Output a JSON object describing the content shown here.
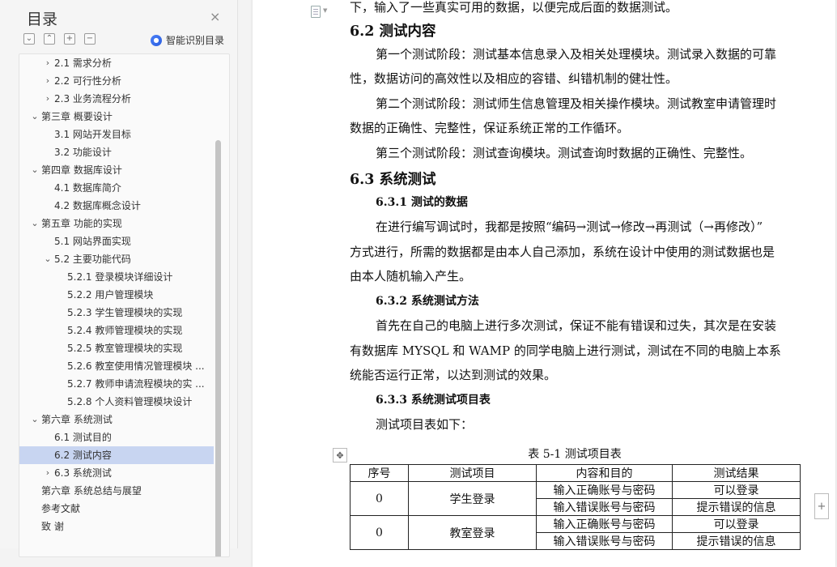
{
  "sidebar": {
    "title": "目录",
    "close_glyph": "×",
    "smart_toc_label": "智能识别目录",
    "tools": [
      {
        "icon": "collapse-all-icon",
        "glyph": "⌄"
      },
      {
        "icon": "expand-all-icon",
        "glyph": "⌃"
      },
      {
        "icon": "add-icon",
        "glyph": "+"
      },
      {
        "icon": "remove-icon",
        "glyph": "−"
      }
    ],
    "toc": [
      {
        "label": "2.1 需求分析",
        "level": 2,
        "caret": "collapsed"
      },
      {
        "label": "2.2 可行性分析",
        "level": 2,
        "caret": "collapsed"
      },
      {
        "label": "2.3  业务流程分析",
        "level": 2,
        "caret": "collapsed"
      },
      {
        "label": "第三章  概要设计",
        "level": 1,
        "caret": "expanded"
      },
      {
        "label": "3.1 网站开发目标",
        "level": 2,
        "caret": "none"
      },
      {
        "label": "3.2 功能设计",
        "level": 2,
        "caret": "none"
      },
      {
        "label": "第四章  数据库设计",
        "level": 1,
        "caret": "expanded"
      },
      {
        "label": "4.1 数据库简介",
        "level": 2,
        "caret": "none"
      },
      {
        "label": "4.2 数据库概念设计",
        "level": 2,
        "caret": "none"
      },
      {
        "label": "第五章  功能的实现",
        "level": 1,
        "caret": "expanded"
      },
      {
        "label": "5.1  网站界面实现",
        "level": 2,
        "caret": "none"
      },
      {
        "label": "5.2  主要功能代码",
        "level": 2,
        "caret": "expanded"
      },
      {
        "label": "5.2.1 登录模块详细设计",
        "level": 3,
        "caret": "none"
      },
      {
        "label": "5.2.2 用户管理模块",
        "level": 3,
        "caret": "none"
      },
      {
        "label": "5.2.3 学生管理模块的实现",
        "level": 3,
        "caret": "none"
      },
      {
        "label": "5.2.4 教师管理模块的实现",
        "level": 3,
        "caret": "none"
      },
      {
        "label": "5.2.5 教室管理模块的实现",
        "level": 3,
        "caret": "none"
      },
      {
        "label": "5.2.6 教室使用情况管理模块 ...",
        "level": 3,
        "caret": "none"
      },
      {
        "label": "5.2.7 教师申请流程模块的实 ...",
        "level": 3,
        "caret": "none"
      },
      {
        "label": "5.2.8 个人资料管理模块设计",
        "level": 3,
        "caret": "none"
      },
      {
        "label": "第六章  系统测试",
        "level": 1,
        "caret": "expanded"
      },
      {
        "label": "6.1  测试目的",
        "level": 2,
        "caret": "none"
      },
      {
        "label": "6.2  测试内容",
        "level": 2,
        "caret": "none",
        "active": true
      },
      {
        "label": "6.3  系统测试",
        "level": 2,
        "caret": "collapsed"
      },
      {
        "label": "第六章  系统总结与展望",
        "level": 1,
        "caret": "none"
      },
      {
        "label": "参考文献",
        "level": 1,
        "caret": "none"
      },
      {
        "label": "致    谢",
        "level": 1,
        "caret": "none"
      }
    ]
  },
  "document": {
    "lines": [
      {
        "text": "下，输入了一些真实可用的数据，以便完成后面的数据测试。",
        "style": "body"
      },
      {
        "text": "6.2  测试内容",
        "style": "h2"
      },
      {
        "text": "第一个测试阶段：测试基本信息录入及相关处理模块。测试录入数据的可靠",
        "style": "indent"
      },
      {
        "text": "性，数据访问的高效性以及相应的容错、纠错机制的健壮性。",
        "style": "body"
      },
      {
        "text": "第二个测试阶段：测试师生信息管理及相关操作模块。测试教室申请管理时",
        "style": "indent"
      },
      {
        "text": "数据的正确性、完整性，保证系统正常的工作循环。",
        "style": "body"
      },
      {
        "text": "第三个测试阶段：测试查询模块。测试查询时数据的正确性、完整性。",
        "style": "indent"
      },
      {
        "text": "6.3  系统测试",
        "style": "h2"
      },
      {
        "text": "6.3.1  测试的数据",
        "style": "h3"
      },
      {
        "text": "在进行编写调试时，我都是按照“编码→测试→修改→再测试（→再修改）”",
        "style": "indent"
      },
      {
        "text": "方式进行，所需的数据都是由本人自己添加，系统在设计中使用的测试数据也是",
        "style": "body"
      },
      {
        "text": "由本人随机输入产生。",
        "style": "body"
      },
      {
        "text": "6.3.2  系统测试方法",
        "style": "h3"
      },
      {
        "text": "首先在自己的电脑上进行多次测试，保证不能有错误和过失，其次是在安装",
        "style": "indent"
      },
      {
        "text": "有数据库 MYSQL 和 WAMP 的同学电脑上进行测试，测试在不同的电脑上本系",
        "style": "body"
      },
      {
        "text": "统能否运行正常，以达到测试的效果。",
        "style": "body"
      },
      {
        "text": "6.3.3  系统测试项目表",
        "style": "h3"
      },
      {
        "text": "测试项目表如下：",
        "style": "indent"
      }
    ],
    "table_caption": "表 5-1  测试项目表",
    "table_headers": [
      "序号",
      "测试项目",
      "内容和目的",
      "测试结果"
    ],
    "table_rows": [
      {
        "no": "0",
        "item": "学生登录",
        "cases": [
          [
            "输入正确账号与密码",
            "可以登录"
          ],
          [
            "输入错误账号与密码",
            "提示错误的信息"
          ]
        ]
      },
      {
        "no": "0",
        "item": "教室登录",
        "cases": [
          [
            "输入正确账号与密码",
            "可以登录"
          ],
          [
            "输入错误账号与密码",
            "提示错误的信息"
          ]
        ]
      }
    ]
  }
}
